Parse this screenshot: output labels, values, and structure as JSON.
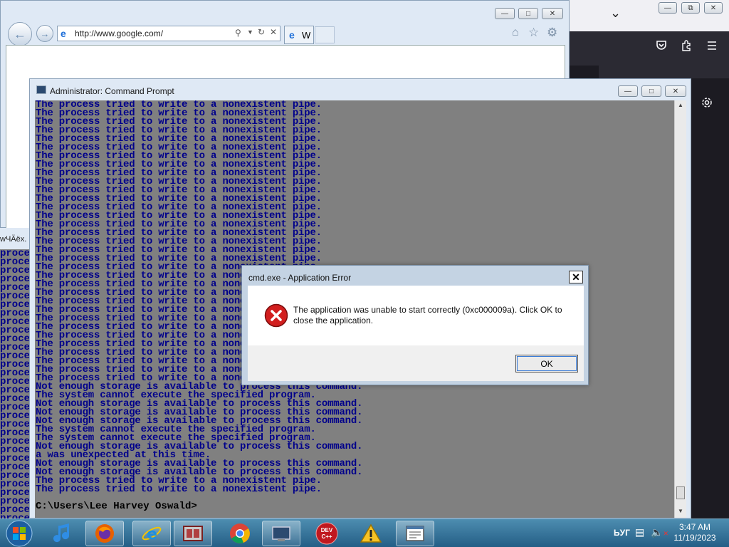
{
  "browser_dark": {
    "chevron": "⌄",
    "icons": [
      "pocket-icon",
      "extensions-icon",
      "menu-icon",
      "settings-icon"
    ]
  },
  "ie": {
    "url": "http://www.google.com/",
    "tab_label": "W"
  },
  "bg_cmd": {
    "title_fragment": "wЧÄëx.",
    "line_fragment": "process"
  },
  "cmd": {
    "title": "Administrator: Command Prompt",
    "lines_part1": [
      "The process tried to write to a nonexistent pipe.",
      "The process tried to write to a nonexistent pipe.",
      "The process tried to write to a nonexistent pipe.",
      "The process tried to write to a nonexistent pipe.",
      "The process tried to write to a nonexistent pipe.",
      "The process tried to write to a nonexistent pipe.",
      "The process tried to write to a nonexistent pipe.",
      "The process tried to write to a nonexistent pipe.",
      "The process tried to write to a nonexistent pipe.",
      "The process tried to write to a nonexistent pipe.",
      "The process tried to write to a nonexistent pipe.",
      "The process tried to write to a nonexistent pipe.",
      "The process tried to write to a nonexistent pipe.",
      "The process tried to write to a nonexistent pipe.",
      "The process tried to write to a nonexistent pipe.",
      "The process tried to write to a nonexistent pipe.",
      "The process tried to write to a nonexistent pipe.",
      "The process tried to write to a nonexistent pipe.",
      "The process tried to write to a nonexistent pipe.",
      "The process tried to write to a nonexistent pipe.",
      "The process tried to write to a nonexistent pipe.",
      "The process tried to write to a nonexistent pipe.",
      "The process tried to write to a nonexistent pipe.",
      "The process tried to write to a nonexistent pipe.",
      "The process tried to write to a nonexistent pipe.",
      "The process tried to write to a nonexistent pipe.",
      "The process tried to write to a nonexistent pipe.",
      "The process tried to write to a nonexistent pipe.",
      "The process tried to write to a nonexistent pipe.",
      "The process tried to write to a nonexistent pipe.",
      "The process tried to write to a nonexistent pipe.",
      "The process tried to write to a nonexistent pipe.",
      "The process tried to write to a nonexistent pipe."
    ],
    "lines_part2": [
      "Not enough storage is available to process this command.",
      "The system cannot execute the specified program.",
      "Not enough storage is available to process this command.",
      "Not enough storage is available to process this command.",
      "Not enough storage is available to process this command.",
      "The system cannot execute the specified program.",
      "The system cannot execute the specified program.",
      "Not enough storage is available to process this command.",
      "a was unexpected at this time.",
      "Not enough storage is available to process this command.",
      "Not enough storage is available to process this command.",
      "The process tried to write to a nonexistent pipe.",
      "The process tried to write to a nonexistent pipe."
    ],
    "prompt": "C:\\Users\\Lee Harvey Oswald>"
  },
  "dialog": {
    "title": "cmd.exe - Application Error",
    "message": "The application was unable to start correctly (0xc000009a). Click OK to close the application.",
    "ok_label": "OK"
  },
  "taskbar": {
    "time": "3:47 AM",
    "date": "11/19/2023",
    "tray_text": "ЬУГ",
    "devcpp_label": "DEV C++"
  },
  "colors": {
    "console_bg": "#808080",
    "console_text": "#00008b",
    "error_red": "#d21f1f"
  }
}
